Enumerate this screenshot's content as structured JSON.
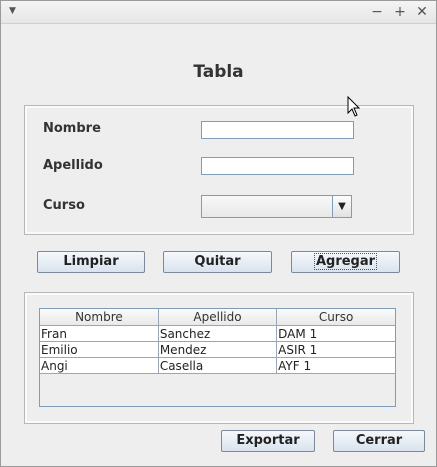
{
  "window": {
    "title": "",
    "menu_icon": "chevron-down-icon",
    "minimize_glyph": "−",
    "maximize_glyph": "+",
    "close_glyph": "✕"
  },
  "header": {
    "title": "Tabla"
  },
  "form": {
    "nombre_label": "Nombre",
    "nombre_value": "",
    "apellido_label": "Apellido",
    "apellido_value": "",
    "curso_label": "Curso",
    "curso_selected": ""
  },
  "actions": {
    "limpiar": "Limpiar",
    "quitar": "Quitar",
    "agregar": "Agregar"
  },
  "table": {
    "columns": [
      "Nombre",
      "Apellido",
      "Curso"
    ],
    "rows": [
      [
        "Fran",
        "Sanchez",
        "DAM 1"
      ],
      [
        "Emilio",
        "Mendez",
        "ASIR 1"
      ],
      [
        "Angi",
        "Casella",
        "AYF 1"
      ]
    ]
  },
  "footer": {
    "exportar": "Exportar",
    "cerrar": "Cerrar"
  }
}
